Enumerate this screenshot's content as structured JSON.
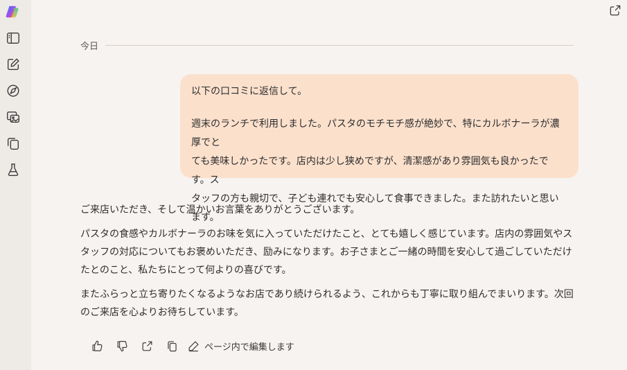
{
  "sidebar": {
    "logo_icon": "copilot-logo-icon",
    "items": [
      {
        "icon": "sidebar-toggle-icon"
      },
      {
        "icon": "new-chat-icon"
      },
      {
        "icon": "discover-icon"
      },
      {
        "icon": "image-gallery-icon"
      },
      {
        "icon": "pages-icon"
      },
      {
        "icon": "labs-flask-icon"
      }
    ]
  },
  "header": {
    "share_icon": "share-icon"
  },
  "conversation": {
    "date_label": "今日",
    "user_message": {
      "line1": "以下の口コミに返信して。",
      "review_lines": [
        "週末のランチで利用しました。パスタのモチモチ感が絶妙で、特にカルボナーラが濃厚でと",
        "ても美味しかったです。店内は少し狭めですが、清潔感があり雰囲気も良かったです。ス",
        "タッフの方も親切で、子ども連れでも安心して食事できました。また訪れたいと思います。"
      ]
    },
    "assistant_reply": {
      "p1": "ご来店いただき、そして温かいお言葉をありがとうございます。",
      "p2": "パスタの食感やカルボナーラのお味を気に入っていただけたこと、とても嬉しく感じています。店内の雰囲気やスタッフの対応についてもお褒めいただき、励みになります。お子さまとご一緒の時間を安心して過ごしていただけたとのこと、私たちにとって何よりの喜びです。",
      "p3": "またふらっと立ち寄りたくなるようなお店であり続けられるよう、これからも丁寧に取り組んでまいります。次回のご来店を心よりお待ちしています。"
    },
    "actions": {
      "edit_in_page_label": "ページ内で編集します"
    }
  },
  "colors": {
    "background": "#f7f3f0",
    "sidebar": "#eeeae6",
    "user_bubble": "#fbe0cc",
    "text": "#2d2d2d"
  }
}
